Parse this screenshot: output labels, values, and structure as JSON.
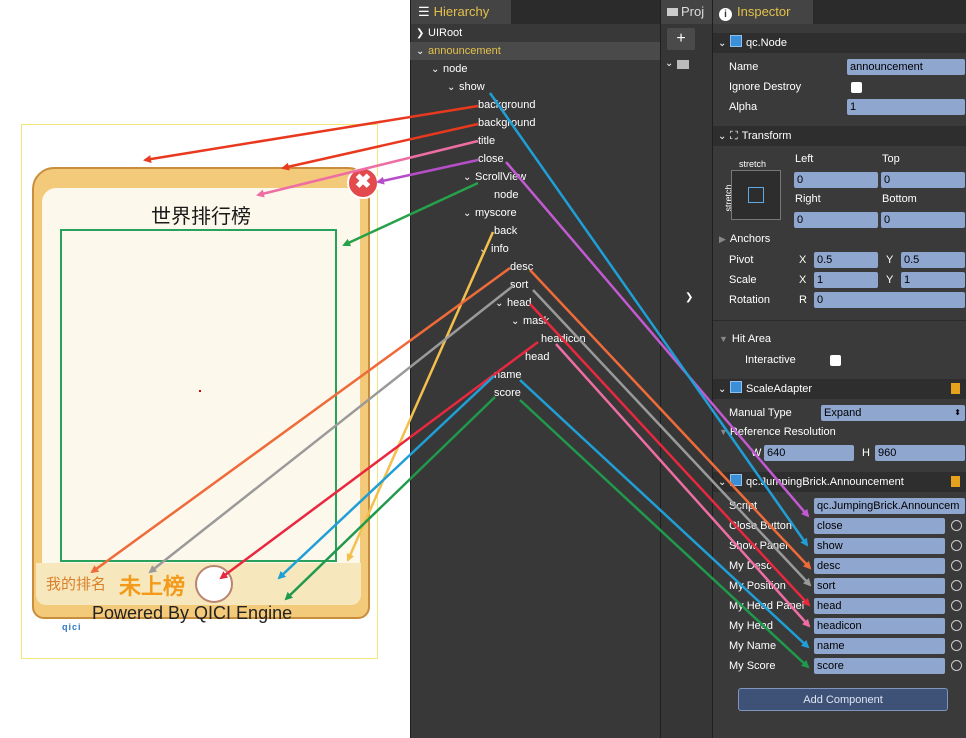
{
  "scene": {
    "title": "世界排行榜",
    "desc": "我的排名",
    "sort": "未上榜",
    "powered": "Powered By QICI Engine",
    "logo": "qici",
    "close_glyph": "✖"
  },
  "hierarchy": {
    "tab_label": "Hierarchy",
    "rows": [
      "UIRoot",
      "announcement",
      "node",
      "show",
      "background",
      "background",
      "title",
      "close",
      "ScrollView",
      "node",
      "myscore",
      "back",
      "info",
      "desc",
      "sort",
      "head",
      "mask",
      "headicon",
      "head",
      "name",
      "score"
    ]
  },
  "project": {
    "tab_label": "Proj",
    "add_glyph": "+"
  },
  "inspector": {
    "tab_label": "Inspector",
    "qc_node": {
      "header": "qc.Node",
      "name_label": "Name",
      "name_value": "announcement",
      "ignore_destroy_label": "Ignore Destroy",
      "alpha_label": "Alpha",
      "alpha_value": "1"
    },
    "transform": {
      "header": "Transform",
      "stretch_top": "stretch",
      "stretch_side": "stretch",
      "left_label": "Left",
      "top_label": "Top",
      "left_value": "0",
      "top_value": "0",
      "right_label": "Right",
      "bottom_label": "Bottom",
      "right_value": "0",
      "bottom_value": "0",
      "anchors_label": "Anchors",
      "pivot_label": "Pivot",
      "pivot_x": "0.5",
      "pivot_y": "0.5",
      "scale_label": "Scale",
      "scale_x": "1",
      "scale_y": "1",
      "rotation_label": "Rotation",
      "rotation_value": "0",
      "x_label": "X",
      "y_label": "Y",
      "r_label": "R"
    },
    "hit_area": {
      "header": "Hit Area",
      "interactive_label": "Interactive"
    },
    "scale_adapter": {
      "header": "ScaleAdapter",
      "manual_type_label": "Manual Type",
      "manual_type_value": "Expand",
      "ref_res_label": "Reference Resolution",
      "w_label": "W",
      "w_value": "640",
      "h_label": "H",
      "h_value": "960"
    },
    "announcement": {
      "header": "qc.JumpingBrick.Announcement",
      "script_label": "Script",
      "script_value": "qc.JumpingBrick.Announcem",
      "props": [
        {
          "label": "Close Button",
          "value": "close"
        },
        {
          "label": "Show Panel",
          "value": "show"
        },
        {
          "label": "My Desc",
          "value": "desc"
        },
        {
          "label": "My Position",
          "value": "sort"
        },
        {
          "label": "My Head Panel",
          "value": "head"
        },
        {
          "label": "My Head",
          "value": "headicon"
        },
        {
          "label": "My Name",
          "value": "name"
        },
        {
          "label": "My Score",
          "value": "score"
        }
      ]
    },
    "add_component": "Add Component"
  },
  "colors": {
    "panel_dark": "#383838",
    "accent_yellow": "#e3c14a",
    "field_blue": "#8fa6cf"
  }
}
